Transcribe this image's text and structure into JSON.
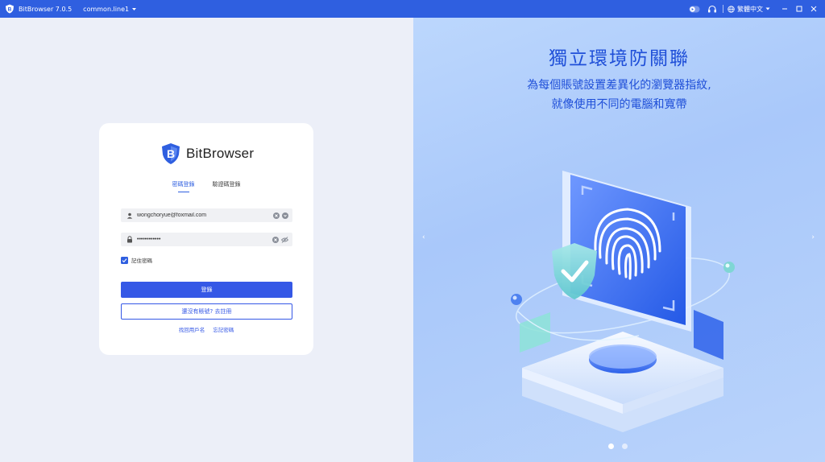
{
  "titlebar": {
    "app_title": "BitBrowser 7.0.5",
    "profile": "common.line1",
    "language": "繁體中文",
    "logo_icon": "bitbrowser-logo-icon",
    "icons": [
      "record-toggle-icon",
      "headset-icon",
      "globe-icon",
      "minimize-icon",
      "maximize-icon",
      "close-icon"
    ]
  },
  "login": {
    "brand_name": "BitBrowser",
    "tabs": [
      "密碼登錄",
      "驗證碼登錄"
    ],
    "active_tab": 0,
    "username": "wongchoryue@foxmail.com",
    "password": "••••••••••••",
    "remember_label": "記住密碼",
    "remember_checked": true,
    "login_button": "登錄",
    "register_button": "還沒有賬號?  去註冊",
    "links": [
      "找回用戶名",
      "忘記密碼"
    ]
  },
  "hero": {
    "title": "獨立環境防關聯",
    "subtitle_line1": "為每個賬號設置差異化的瀏覽器指紋,",
    "subtitle_line2": "就像使用不同的電腦和寬帶",
    "slide_count": 2,
    "active_slide": 0,
    "illustration_icon": "fingerprint-shield-illustration",
    "accent_color": "#1f4fd8"
  },
  "colors": {
    "titlebar": "#2f5fe0",
    "primary_button": "#3558e6"
  }
}
